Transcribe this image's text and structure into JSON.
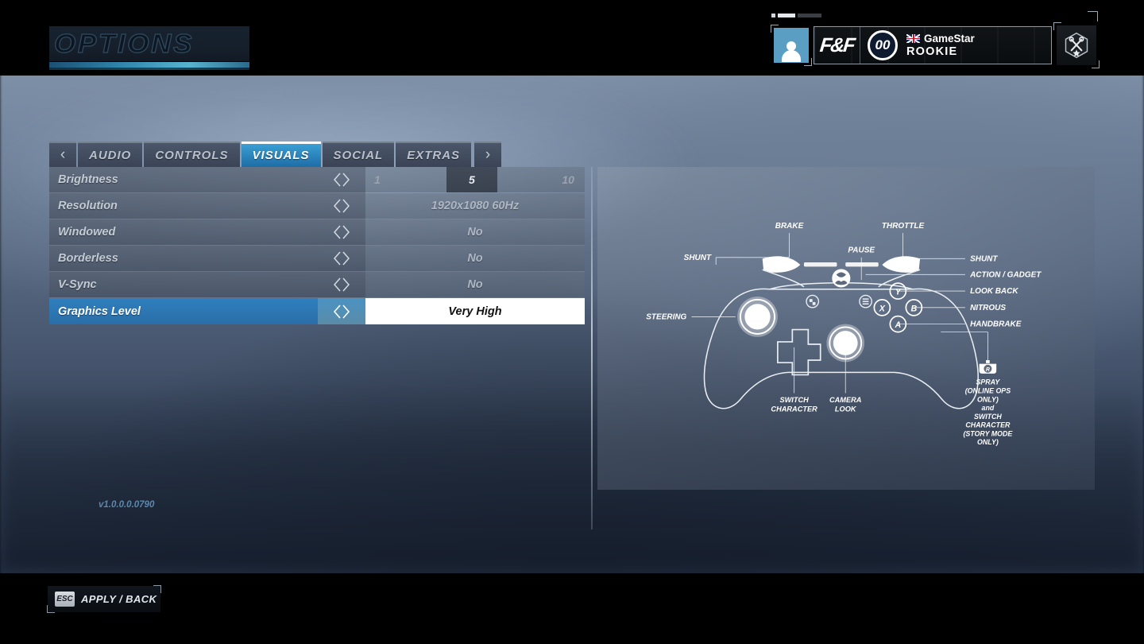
{
  "page_title": "OPTIONS",
  "version": "v1.0.0.0.0790",
  "hud": {
    "avatar_icon": "person-icon",
    "franchise_logo": "F&F",
    "level_badge": "00",
    "gamer_name": "GameStar",
    "gamer_rank": "ROOKIE",
    "flag_icon": "uk-flag-icon",
    "tools_icon": "crossed-wrenches-icon"
  },
  "tabs": {
    "prev_arrow": "‹",
    "next_arrow": "›",
    "items": [
      {
        "label": "AUDIO",
        "active": false
      },
      {
        "label": "CONTROLS",
        "active": false
      },
      {
        "label": "VISUALS",
        "active": true
      },
      {
        "label": "SOCIAL",
        "active": false
      },
      {
        "label": "EXTRAS",
        "active": false
      }
    ]
  },
  "settings": {
    "arrows_glyph": "◇",
    "rows": [
      {
        "label": "Brightness",
        "type": "slider",
        "min": "1",
        "value": "5",
        "max": "10",
        "selected": false
      },
      {
        "label": "Resolution",
        "type": "value",
        "value": "1920x1080 60Hz",
        "selected": false
      },
      {
        "label": "Windowed",
        "type": "value",
        "value": "No",
        "selected": false
      },
      {
        "label": "Borderless",
        "type": "value",
        "value": "No",
        "selected": false
      },
      {
        "label": "V-Sync",
        "type": "value",
        "value": "No",
        "selected": false
      },
      {
        "label": "Graphics Level",
        "type": "value",
        "value": "Very High",
        "selected": true
      }
    ]
  },
  "controller": {
    "diagram_name": "xbox-controller-diagram",
    "labels": {
      "brake": "BRAKE",
      "throttle": "THROTTLE",
      "shunt_left": "SHUNT",
      "shunt_right": "SHUNT",
      "pause": "PAUSE",
      "steering": "STEERING",
      "action_gadget": "ACTION / GADGET",
      "look_back": "LOOK BACK",
      "nitrous": "NITROUS",
      "handbrake": "HANDBRAKE",
      "switch_character": "SWITCH CHARACTER",
      "camera_look": "CAMERA LOOK"
    },
    "face_buttons": {
      "y": "Y",
      "x": "X",
      "b": "B",
      "a": "A"
    },
    "bumper_icon_label": "R",
    "spray_note": [
      "SPRAY",
      "(ONLINE OPS",
      "ONLY)",
      "and",
      "SWITCH",
      "CHARACTER",
      "(STORY MODE",
      "ONLY)"
    ]
  },
  "footer": {
    "key": "ESC",
    "label": "APPLY / BACK"
  },
  "colors": {
    "accent_blue": "#2f7fbe",
    "tab_active": "#3b9fd4",
    "title_underline": "#57b4cf",
    "version_text": "#5d87ad",
    "button_y": "#e8c23a",
    "button_x": "#3aa9e0",
    "button_b": "#e0343c",
    "button_a": "#4caf50"
  }
}
